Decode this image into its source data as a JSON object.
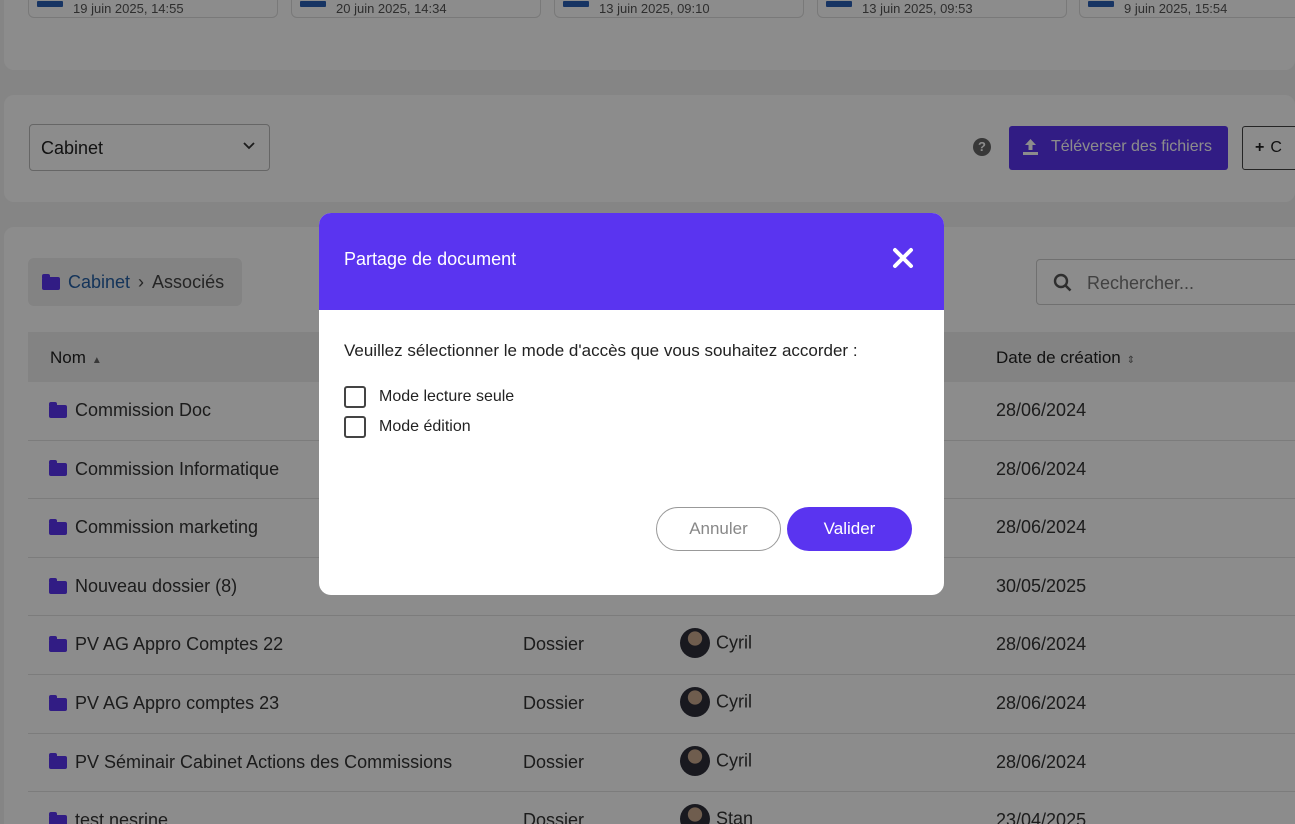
{
  "recent": {
    "tiles": [
      "19 juin 2025, 14:55",
      "20 juin 2025, 14:34",
      "13 juin 2025, 09:10",
      "13 juin 2025, 09:53",
      "9 juin 2025, 15:54"
    ]
  },
  "toolbar": {
    "space_select": "Cabinet",
    "upload_label": "Téléverser des fichiers",
    "create_label": "C"
  },
  "breadcrumb": {
    "root": "Cabinet",
    "current": "Associés"
  },
  "search": {
    "placeholder": "Rechercher..."
  },
  "table": {
    "headers": {
      "name": "Nom",
      "date": "Date de création"
    },
    "rows": [
      {
        "name": "Commission Doc",
        "type": "",
        "owner": "",
        "date": "28/06/2024"
      },
      {
        "name": "Commission Informatique",
        "type": "",
        "owner": "",
        "date": "28/06/2024"
      },
      {
        "name": "Commission marketing",
        "type": "",
        "owner": "",
        "date": "28/06/2024"
      },
      {
        "name": "Nouveau dossier (8)",
        "type": "",
        "owner": "",
        "date": "30/05/2025"
      },
      {
        "name": "PV AG Appro Comptes 22",
        "type": "Dossier",
        "owner": "Cyril",
        "date": "28/06/2024"
      },
      {
        "name": "PV AG Appro comptes 23",
        "type": "Dossier",
        "owner": "Cyril",
        "date": "28/06/2024"
      },
      {
        "name": "PV Séminair Cabinet Actions des Commissions",
        "type": "Dossier",
        "owner": "Cyril",
        "date": "28/06/2024"
      },
      {
        "name": "test nesrine",
        "type": "Dossier",
        "owner": "Stan",
        "date": "23/04/2025"
      }
    ]
  },
  "modal": {
    "title": "Partage de document",
    "prompt": "Veuillez sélectionner le mode d'accès que vous souhaitez accorder :",
    "options": [
      "Mode lecture seule",
      "Mode édition"
    ],
    "cancel_label": "Annuler",
    "validate_label": "Valider"
  },
  "colors": {
    "accent": "#5a34f0",
    "link": "#2660a4"
  }
}
